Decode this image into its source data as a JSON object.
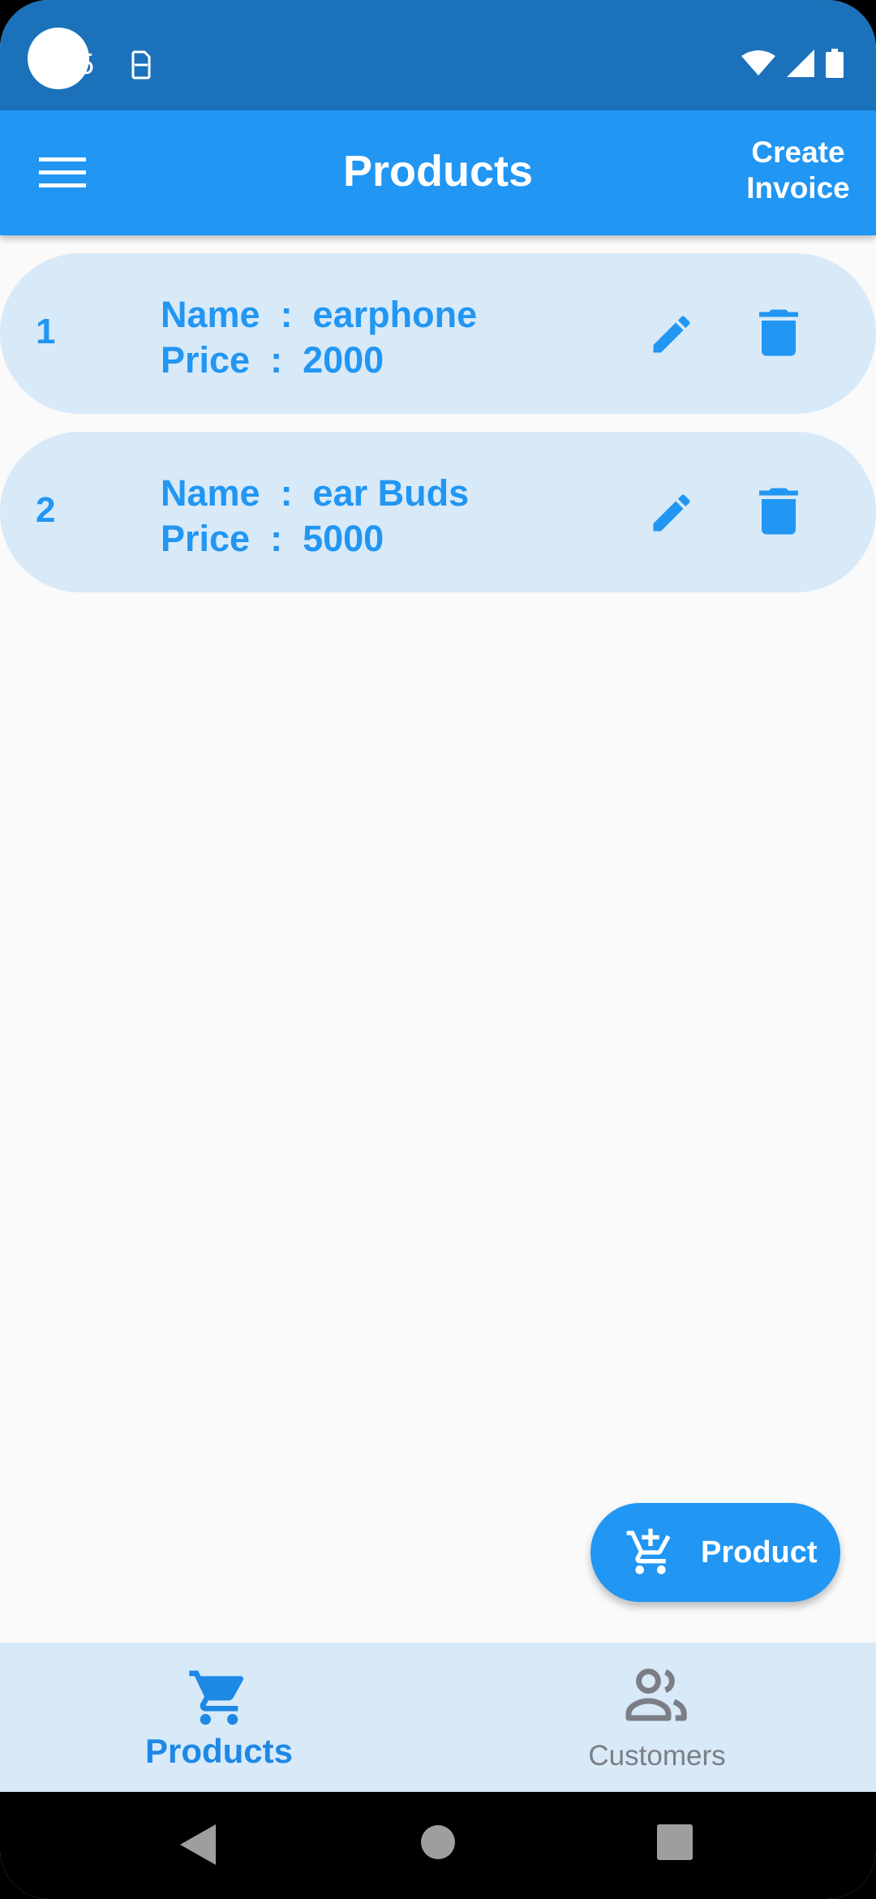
{
  "status_bar": {
    "time": "5"
  },
  "app_bar": {
    "title": "Products",
    "action": "Create\nInvoice"
  },
  "products": [
    {
      "index": "1",
      "name_line": "Name  :  earphone",
      "price_line": "Price  :  2000"
    },
    {
      "index": "2",
      "name_line": "Name  :  ear Buds",
      "price_line": "Price  :  5000"
    }
  ],
  "fab": {
    "label": "Product",
    "icon": "add-shopping-cart-icon"
  },
  "bottom_nav": {
    "items": [
      {
        "label": "Products",
        "icon": "cart-icon",
        "active": true
      },
      {
        "label": "Customers",
        "icon": "people-icon",
        "active": false
      }
    ]
  },
  "colors": {
    "primary": "#2196f3",
    "status_bar": "#1b72bb",
    "card": "#d8e9f8",
    "inactive": "#7b7f85"
  }
}
